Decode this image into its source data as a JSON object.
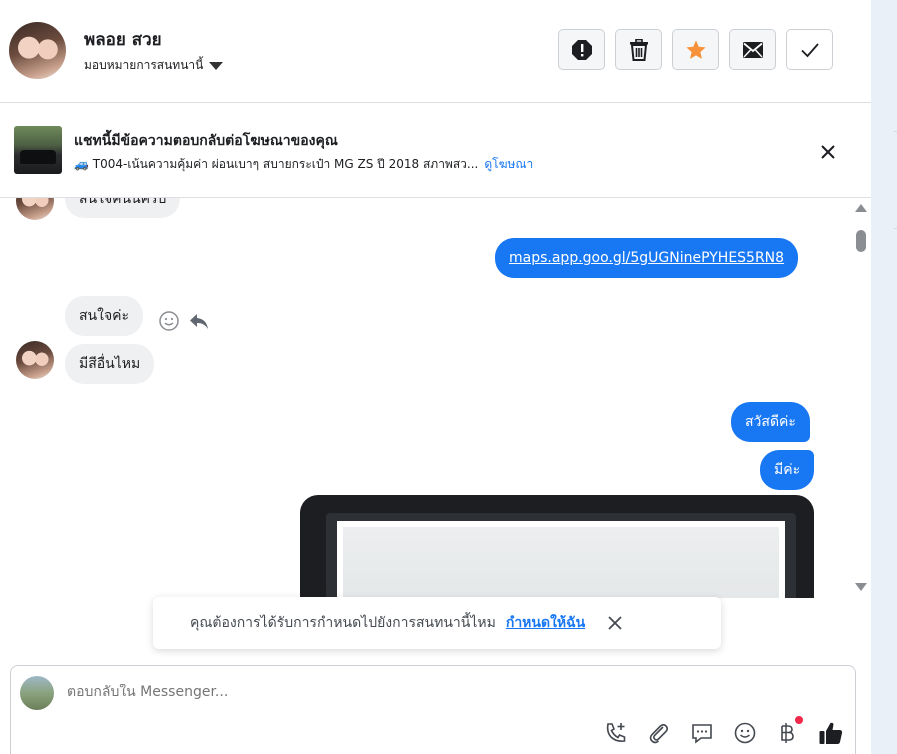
{
  "header": {
    "contact_name": "พลอย สวย",
    "assign_label": "มอบหมายการสนทนานี้",
    "actions": [
      "spam-icon",
      "trash-icon",
      "star-icon",
      "mail-icon",
      "check-icon"
    ]
  },
  "ad": {
    "title": "แชทนี้มีข้อความตอบกลับต่อโฆษณาของคุณ",
    "subtitle": "🚙 T004-เน้นความคุ้มค่า ผ่อนเบาๆ สบายกระเป๋า MG ZS ปี 2018 สภาพสว...",
    "link": "ดูโฆษณา"
  },
  "messages": {
    "partial_in": "สนใจคันนี้ครับ",
    "out_link": "maps.app.goo.gl/5gUGNinePYHES5RN8",
    "in_1": "สนใจค่ะ",
    "in_2": "มีสีอื่นไหม",
    "out_1": "สวัสดีค่ะ",
    "out_2": "มีค่ะ"
  },
  "toast": {
    "text": "คุณต้องการได้รับการกำหนดไปยังการสนทนานี้ไหม",
    "link": "กำหนดให้ฉัน"
  },
  "composer": {
    "placeholder": "ตอบกลับใน Messenger..."
  },
  "colors": {
    "accent": "#1877f2",
    "star": "#f7923a",
    "notification": "#f02849"
  }
}
